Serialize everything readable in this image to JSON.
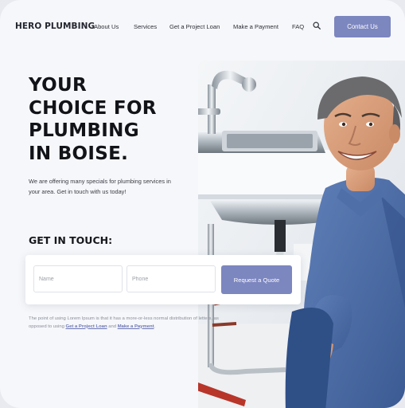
{
  "header": {
    "logo": "HERO PLUMBING",
    "nav": [
      "About Us",
      "Services",
      "Get a Project Loan",
      "Make a Payment",
      "FAQ"
    ],
    "search_icon": "search-icon",
    "contact_label": "Contact Us"
  },
  "hero": {
    "title_lines": [
      "YOUR",
      "CHOICE FOR",
      "PLUMBING",
      "IN BOISE."
    ],
    "subtitle": "We are offering many specials for plumbing services in your area. Get in touch with us today!"
  },
  "contact_form": {
    "title": "GET IN TOUCH:",
    "name_placeholder": "Name",
    "phone_placeholder": "Phone",
    "submit_label": "Request a Quote"
  },
  "footnote": {
    "text_before": "The point of using Lorem Ipsum is that it has a more-or-less normal distribution of letters, as opposed to using",
    "link1": "Get a Project Loan",
    "and": "and",
    "link2": "Make a Payment",
    "end": "."
  },
  "colors": {
    "accent": "#7c86bf",
    "background": "#f6f7fa",
    "heading": "#111318"
  }
}
